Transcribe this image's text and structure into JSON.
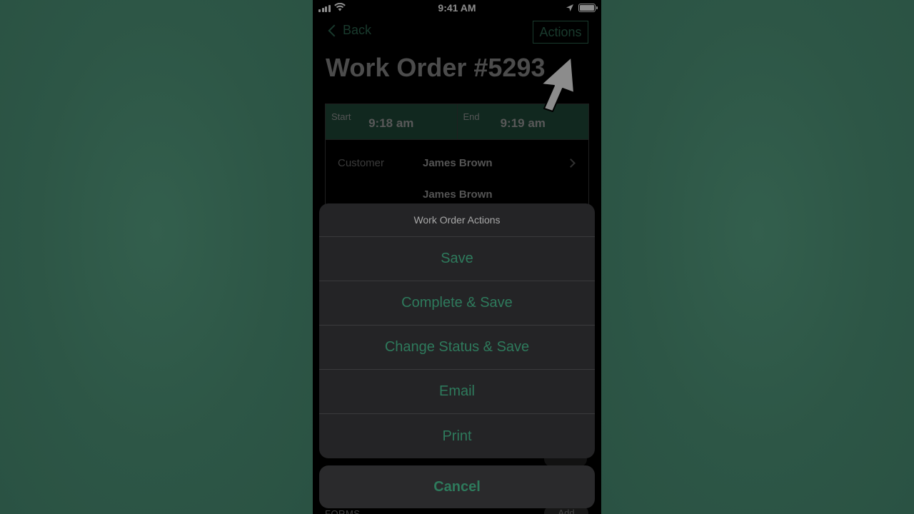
{
  "status_bar": {
    "time": "9:41 AM"
  },
  "nav": {
    "back_label": "Back",
    "actions_label": "Actions"
  },
  "page": {
    "title": "Work Order #5293"
  },
  "times": {
    "start_label": "Start",
    "start_value": "9:18 am",
    "end_label": "End",
    "end_value": "9:19 am"
  },
  "customer": {
    "label": "Customer",
    "name": "James Brown",
    "contact": "James Brown"
  },
  "forms": {
    "label": "FORMS",
    "add_label": "Add"
  },
  "action_sheet": {
    "title": "Work Order Actions",
    "items": [
      "Save",
      "Complete & Save",
      "Change Status & Save",
      "Email",
      "Print"
    ],
    "cancel_label": "Cancel"
  },
  "colors": {
    "accent": "#2e7a5c",
    "background": "#2d5646"
  },
  "icons": [
    "signal-icon",
    "wifi-icon",
    "location-icon",
    "battery-icon",
    "back-chevron-icon",
    "chevron-right-icon",
    "cursor-pointer-icon"
  ]
}
